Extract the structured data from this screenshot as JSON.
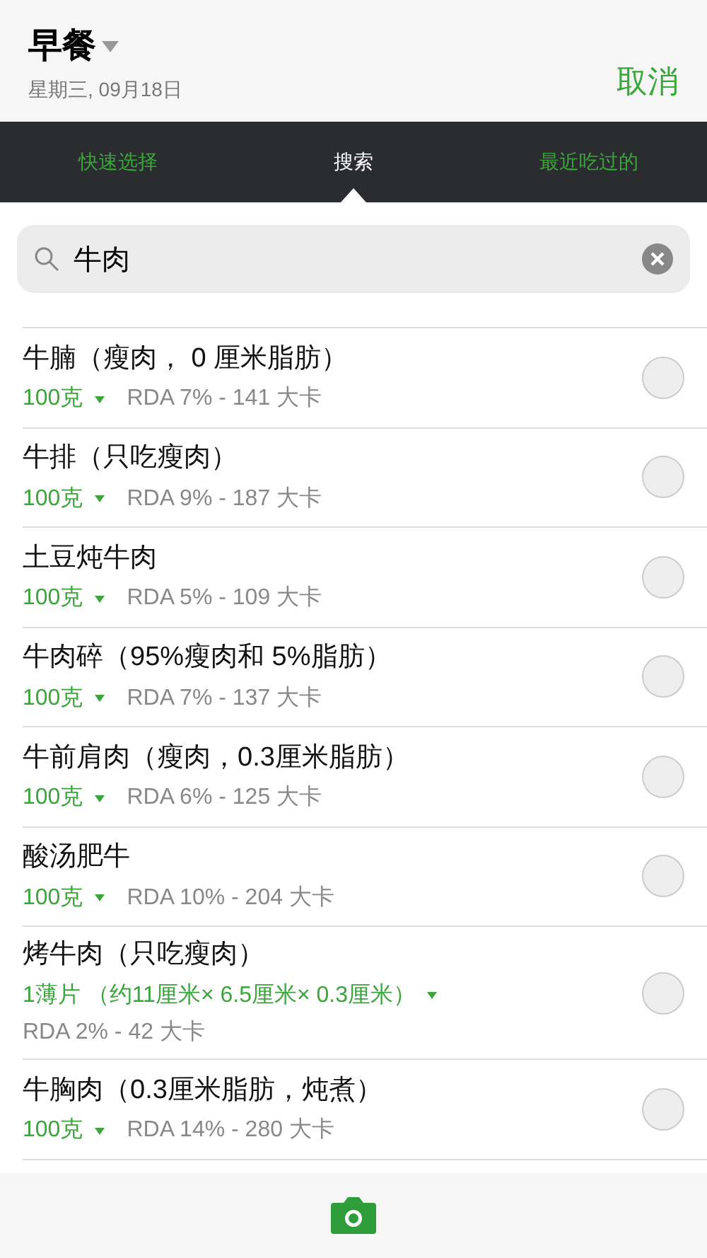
{
  "header": {
    "title": "早餐",
    "date": "星期三, 09月18日",
    "cancel": "取消"
  },
  "tabs": [
    {
      "label": "快速选择",
      "selected": false
    },
    {
      "label": "搜索",
      "selected": true
    },
    {
      "label": "最近吃过的",
      "selected": false
    }
  ],
  "search": {
    "value": "牛肉"
  },
  "items": [
    {
      "kind": "inline",
      "name": "牛腩（瘦肉， 0 厘米脂肪）",
      "serving": "100克",
      "info": "RDA 7% - 141 大卡",
      "selected": false
    },
    {
      "kind": "inline",
      "name": "牛排（只吃瘦肉）",
      "serving": "100克",
      "info": "RDA 9% - 187 大卡",
      "selected": false
    },
    {
      "kind": "inline",
      "name": "土豆炖牛肉",
      "serving": "100克",
      "info": "RDA 5% - 109 大卡",
      "selected": false
    },
    {
      "kind": "inline",
      "name": "牛肉碎（95%瘦肉和 5%脂肪）",
      "serving": "100克",
      "info": "RDA 7% - 137 大卡",
      "selected": false
    },
    {
      "kind": "inline",
      "name": "牛前肩肉（瘦肉，0.3厘米脂肪）",
      "serving": "100克",
      "info": "RDA 6% - 125 大卡",
      "selected": false
    },
    {
      "kind": "inline",
      "name": "酸汤肥牛",
      "serving": "100克",
      "info": "RDA 10% - 204 大卡",
      "selected": false
    },
    {
      "kind": "stacked",
      "name": "烤牛肉（只吃瘦肉）",
      "serving": "1薄片 （约11厘米× 6.5厘米× 0.3厘米）",
      "info": "RDA 2% - 42 大卡",
      "selected": false
    },
    {
      "kind": "inline",
      "name": "牛胸肉（0.3厘米脂肪，炖煮）",
      "serving": "100克",
      "info": "RDA 14% - 280 大卡",
      "selected": false
    }
  ]
}
